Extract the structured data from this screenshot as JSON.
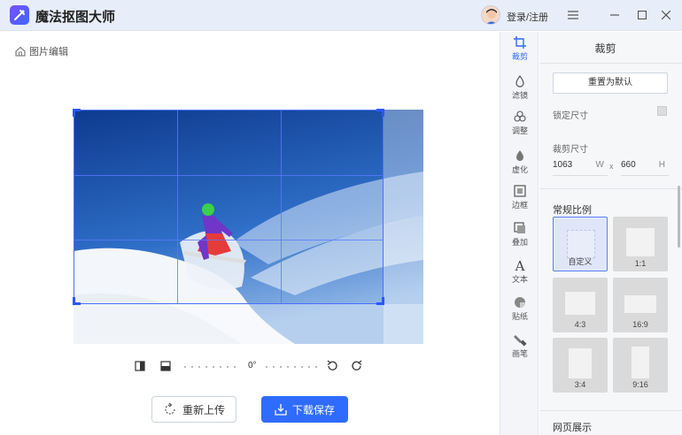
{
  "app": {
    "title": "魔法抠图大师",
    "login_label": "登录/注册"
  },
  "window": {
    "menu_icon": "menu-icon",
    "minimize_icon": "minimize-icon",
    "maximize_icon": "maximize-icon",
    "close_icon": "close-icon"
  },
  "breadcrumb": {
    "label": "图片编辑"
  },
  "rotation": {
    "angle": "0°"
  },
  "actions": {
    "reupload_label": "重新上传",
    "save_label": "下载保存"
  },
  "tools": [
    {
      "label": "裁剪",
      "icon": "crop-icon",
      "active": true
    },
    {
      "label": "滤镜",
      "icon": "filter-icon"
    },
    {
      "label": "调整",
      "icon": "adjust-icon"
    },
    {
      "label": "虚化",
      "icon": "blur-icon"
    },
    {
      "label": "边框",
      "icon": "border-icon"
    },
    {
      "label": "叠加",
      "icon": "overlay-icon"
    },
    {
      "label": "文本",
      "icon": "text-icon"
    },
    {
      "label": "贴纸",
      "icon": "sticker-icon"
    },
    {
      "label": "画笔",
      "icon": "brush-icon"
    }
  ],
  "panel": {
    "title": "裁剪",
    "reset_label": "重置为默认",
    "lock_label": "锁定尺寸",
    "size_label": "裁剪尺寸",
    "width_value": "1063",
    "width_unit": "W",
    "separator": "x",
    "height_value": "660",
    "height_unit": "H",
    "ratio_title": "常规比例",
    "ratios": [
      {
        "label": "自定义",
        "selected": true
      },
      {
        "label": "1:1"
      },
      {
        "label": "4:3"
      },
      {
        "label": "16:9"
      },
      {
        "label": "3:4"
      },
      {
        "label": "9:16"
      }
    ],
    "web_title": "网页展示"
  },
  "colors": {
    "accent": "#2f6bff",
    "titlebar": "#e8eef9",
    "crop_border": "#4a6fff"
  }
}
